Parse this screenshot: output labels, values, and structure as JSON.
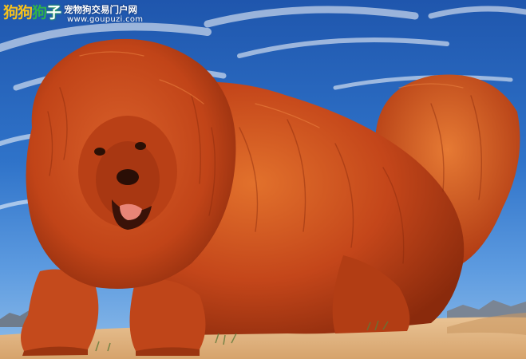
{
  "watermark": {
    "logo_part1": "狗狗",
    "logo_part2": "狗",
    "logo_part3": "子",
    "site_title": "宠物狗交易门户网",
    "site_url": "www.goupuzi.com"
  },
  "colors": {
    "sky_top": "#1f56ad",
    "sky_bottom": "#8fbde9",
    "fur_main": "#c4461a",
    "fur_light": "#e2712c",
    "fur_dark": "#8a2a0c",
    "ground": "#e3b988",
    "logo_yellow": "#f7c21c",
    "logo_green": "#2fb34a"
  },
  "scene": {
    "subject": "dog-icon",
    "background": "sky-icon"
  }
}
